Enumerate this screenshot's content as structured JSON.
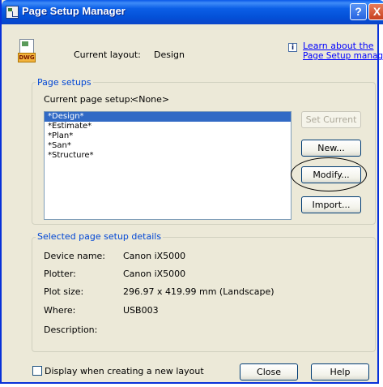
{
  "window": {
    "title": "Page Setup Manager",
    "help_symbol": "?",
    "close_symbol": "X"
  },
  "header": {
    "current_layout_label": "Current layout:",
    "current_layout_value": "Design",
    "learn_link_line1": "Learn about the",
    "learn_link_line2": "Page Setup manager",
    "dwg_label": "DWG",
    "info_symbol": "i"
  },
  "page_setups": {
    "legend": "Page setups",
    "current_label": "Current page setup:",
    "current_value": "<None>",
    "items": [
      "*Design*",
      "*Estimate*",
      "*Plan*",
      "*San*",
      "*Structure*"
    ],
    "selected_index": 0,
    "buttons": {
      "set_current": "Set Current",
      "new": "New...",
      "modify": "Modify...",
      "import": "Import..."
    }
  },
  "details": {
    "legend": "Selected page setup details",
    "device_name_label": "Device name:",
    "device_name_value": "Canon iX5000",
    "plotter_label": "Plotter:",
    "plotter_value": "Canon iX5000",
    "plot_size_label": "Plot size:",
    "plot_size_value": "296.97 x 419.99 mm (Landscape)",
    "where_label": "Where:",
    "where_value": "USB003",
    "description_label": "Description:",
    "description_value": ""
  },
  "footer": {
    "checkbox_label": "Display when creating a new layout",
    "checkbox_checked": false,
    "close_label": "Close",
    "help_label": "Help"
  },
  "colors": {
    "titlebar": "#0a58e8",
    "selection": "#316ac5",
    "link": "#0000ff",
    "group_legend": "#0046d5"
  }
}
